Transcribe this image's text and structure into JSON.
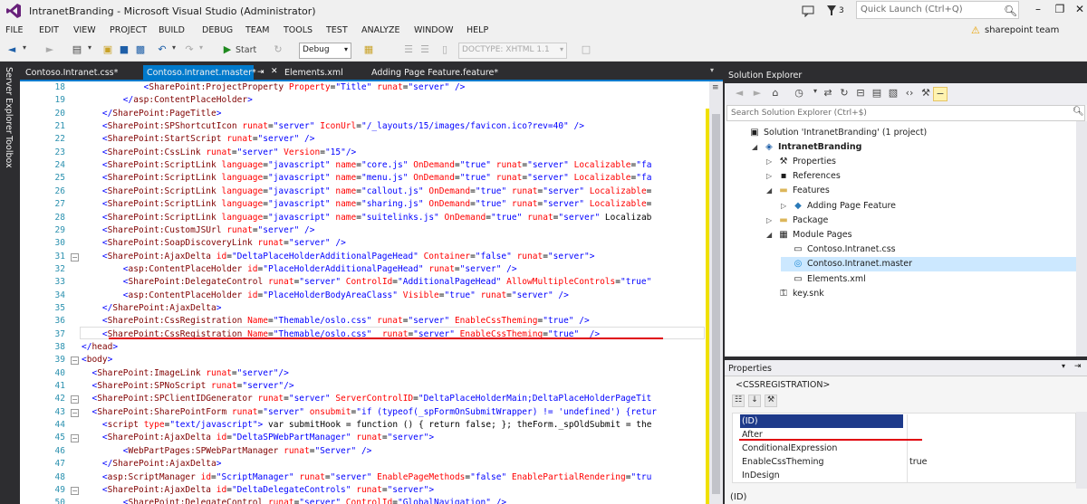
{
  "window": {
    "title": "IntranetBranding - Microsoft Visual Studio (Administrator)",
    "notification_count": "3",
    "quick_launch_placeholder": "Quick Launch (Ctrl+Q)"
  },
  "menu": {
    "items": [
      "FILE",
      "EDIT",
      "VIEW",
      "PROJECT",
      "BUILD",
      "DEBUG",
      "TEAM",
      "TOOLS",
      "TEST",
      "ANALYZE",
      "WINDOW",
      "HELP"
    ],
    "user": "sharepoint team"
  },
  "toolbar": {
    "start_label": "Start",
    "config": "Debug",
    "doctype": "DOCTYPE: XHTML 1.1"
  },
  "side_tabs": [
    "Server Explorer",
    "Toolbox"
  ],
  "doc_tabs": [
    {
      "label": "Contoso.Intranet.css*",
      "active": false
    },
    {
      "label": "Contoso.Intranet.master*",
      "active": true
    },
    {
      "label": "Elements.xml",
      "active": false
    },
    {
      "label": "Adding Page Feature.feature*",
      "active": false
    }
  ],
  "code_lines": [
    {
      "n": "18",
      "text": "            <SharePoint:ProjectProperty Property=\"Title\" runat=\"server\" />"
    },
    {
      "n": "19",
      "text": "        </asp:ContentPlaceHolder>"
    },
    {
      "n": "20",
      "text": "    </SharePoint:PageTitle>"
    },
    {
      "n": "21",
      "text": "    <SharePoint:SPShortcutIcon runat=\"server\" IconUrl=\"/_layouts/15/images/favicon.ico?rev=40\" />"
    },
    {
      "n": "22",
      "text": "    <SharePoint:StartScript runat=\"server\" />"
    },
    {
      "n": "23",
      "text": "    <SharePoint:CssLink runat=\"server\" Version=\"15\"/>"
    },
    {
      "n": "24",
      "text": "    <SharePoint:ScriptLink language=\"javascript\" name=\"core.js\" OnDemand=\"true\" runat=\"server\" Localizable=\"fa"
    },
    {
      "n": "25",
      "text": "    <SharePoint:ScriptLink language=\"javascript\" name=\"menu.js\" OnDemand=\"true\" runat=\"server\" Localizable=\"fa"
    },
    {
      "n": "26",
      "text": "    <SharePoint:ScriptLink language=\"javascript\" name=\"callout.js\" OnDemand=\"true\" runat=\"server\" Localizable="
    },
    {
      "n": "27",
      "text": "    <SharePoint:ScriptLink language=\"javascript\" name=\"sharing.js\" OnDemand=\"true\" runat=\"server\" Localizable="
    },
    {
      "n": "28",
      "text": "    <SharePoint:ScriptLink language=\"javascript\" name=\"suitelinks.js\" OnDemand=\"true\" runat=\"server\" Localizab"
    },
    {
      "n": "29",
      "text": "    <SharePoint:CustomJSUrl runat=\"server\" />"
    },
    {
      "n": "30",
      "text": "    <SharePoint:SoapDiscoveryLink runat=\"server\" />"
    },
    {
      "n": "31",
      "text": "    <SharePoint:AjaxDelta id=\"DeltaPlaceHolderAdditionalPageHead\" Container=\"false\" runat=\"server\">"
    },
    {
      "n": "32",
      "text": "        <asp:ContentPlaceHolder id=\"PlaceHolderAdditionalPageHead\" runat=\"server\" />"
    },
    {
      "n": "33",
      "text": "        <SharePoint:DelegateControl runat=\"server\" ControlId=\"AdditionalPageHead\" AllowMultipleControls=\"true\""
    },
    {
      "n": "34",
      "text": "        <asp:ContentPlaceHolder id=\"PlaceHolderBodyAreaClass\" Visible=\"true\" runat=\"server\" />"
    },
    {
      "n": "35",
      "text": "    </SharePoint:AjaxDelta>"
    },
    {
      "n": "36",
      "text": "    <SharePoint:CssRegistration Name=\"Themable/oslo.css\" runat=\"server\" EnableCssTheming=\"true\" />"
    },
    {
      "n": "37",
      "text": "    <SharePoint:CssRegistration Name=\"Themable/oslo.css\"  runat=\"server\" EnableCssTheming=\"true\"  />"
    },
    {
      "n": "38",
      "text": "</head>"
    },
    {
      "n": "39",
      "text": "<body>"
    },
    {
      "n": "40",
      "text": "  <SharePoint:ImageLink runat=\"server\"/>"
    },
    {
      "n": "41",
      "text": "  <SharePoint:SPNoScript runat=\"server\"/>"
    },
    {
      "n": "42",
      "text": "  <SharePoint:SPClientIDGenerator runat=\"server\" ServerControlID=\"DeltaPlaceHolderMain;DeltaPlaceHolderPageTit"
    },
    {
      "n": "43",
      "text": "  <SharePoint:SharePointForm runat=\"server\" onsubmit=\"if (typeof(_spFormOnSubmitWrapper) != 'undefined') {retur"
    },
    {
      "n": "44",
      "text": "    <script type=\"text/javascript\"> var submitHook = function () { return false; }; theForm._spOldSubmit = the"
    },
    {
      "n": "45",
      "text": "    <SharePoint:AjaxDelta id=\"DeltaSPWebPartManager\" runat=\"server\">"
    },
    {
      "n": "46",
      "text": "        <WebPartPages:SPWebPartManager runat=\"Server\" />"
    },
    {
      "n": "47",
      "text": "    </SharePoint:AjaxDelta>"
    },
    {
      "n": "48",
      "text": "    <asp:ScriptManager id=\"ScriptManager\" runat=\"server\" EnablePageMethods=\"false\" EnablePartialRendering=\"tru"
    },
    {
      "n": "49",
      "text": "    <SharePoint:AjaxDelta id=\"DeltaDelegateControls\" runat=\"server\">"
    },
    {
      "n": "50",
      "text": "        <SharePoint:DelegateControl runat=\"server\" ControlId=\"GlobalNavigation\" />"
    }
  ],
  "solution_explorer": {
    "title": "Solution Explorer",
    "search_placeholder": "Search Solution Explorer (Ctrl+$)",
    "items": [
      {
        "label": "Solution 'IntranetBranding' (1 project)",
        "icon": "solution-icon",
        "depth": 0,
        "arrow": ""
      },
      {
        "label": "IntranetBranding",
        "icon": "project-icon",
        "depth": 1,
        "arrow": "expanded",
        "bold": true
      },
      {
        "label": "Properties",
        "icon": "wrench-icon",
        "depth": 2,
        "arrow": "collapsed"
      },
      {
        "label": "References",
        "icon": "references-icon",
        "depth": 2,
        "arrow": "collapsed"
      },
      {
        "label": "Features",
        "icon": "folder-icon",
        "depth": 2,
        "arrow": "expanded"
      },
      {
        "label": "Adding Page Feature",
        "icon": "feature-icon",
        "depth": 3,
        "arrow": "collapsed"
      },
      {
        "label": "Package",
        "icon": "package-icon",
        "depth": 2,
        "arrow": "collapsed"
      },
      {
        "label": "Module Pages",
        "icon": "module-icon",
        "depth": 2,
        "arrow": "expanded"
      },
      {
        "label": "Contoso.Intranet.css",
        "icon": "css-file-icon",
        "depth": 3,
        "arrow": ""
      },
      {
        "label": "Contoso.Intranet.master",
        "icon": "globe-icon",
        "depth": 3,
        "arrow": "",
        "selected": true
      },
      {
        "label": "Elements.xml",
        "icon": "xml-file-icon",
        "depth": 3,
        "arrow": ""
      },
      {
        "label": "key.snk",
        "icon": "key-icon",
        "depth": 2,
        "arrow": ""
      }
    ]
  },
  "properties": {
    "title": "Properties",
    "object": "<CSSREGISTRATION>",
    "rows": [
      {
        "name": "(ID)",
        "value": "",
        "selected": true
      },
      {
        "name": "After",
        "value": ""
      },
      {
        "name": "ConditionalExpression",
        "value": ""
      },
      {
        "name": "EnableCssTheming",
        "value": "true"
      },
      {
        "name": "InDesign",
        "value": ""
      }
    ],
    "description": "(ID)"
  }
}
